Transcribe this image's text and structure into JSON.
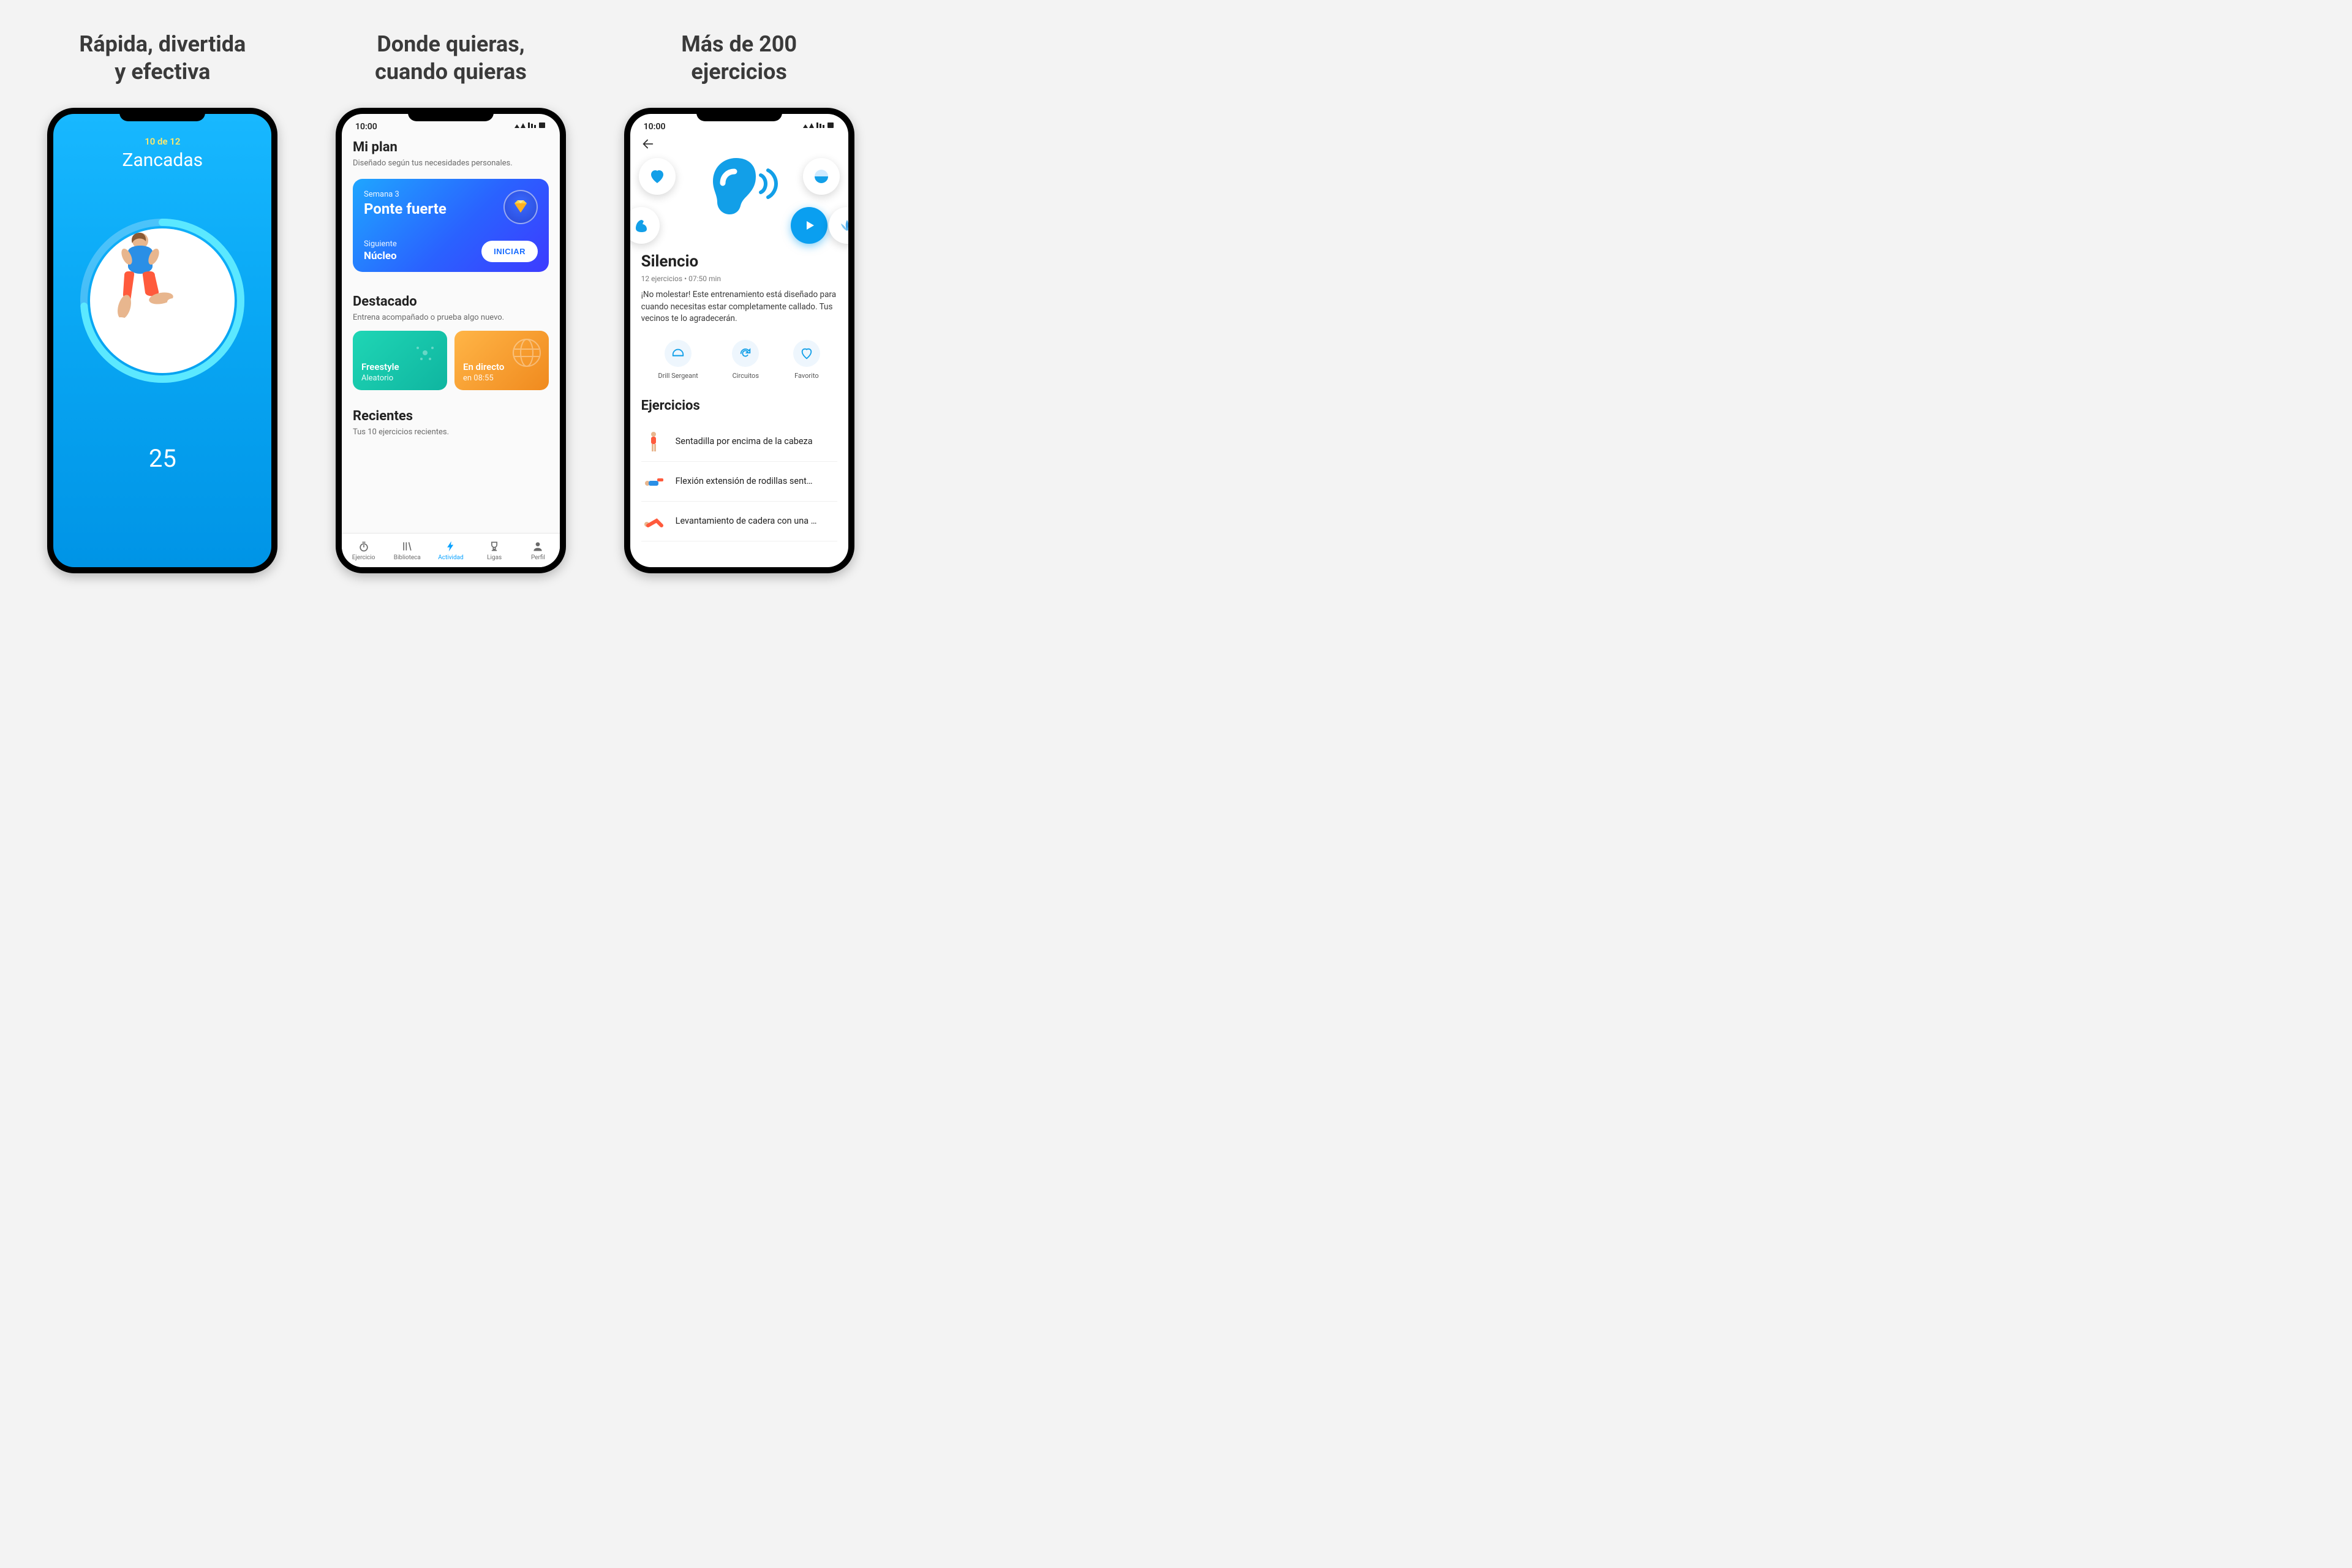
{
  "headlines": [
    "Rápida, divertida\ny efectiva",
    "Donde quieras,\ncuando quieras",
    "Más de 200\nejercicios"
  ],
  "colors": {
    "accent": "#0aa2ff",
    "gradient_plan": "#2a62ff"
  },
  "screen1": {
    "step": "10 de 12",
    "exercise": "Zancadas",
    "reps": "25"
  },
  "screen2": {
    "status_time": "10:00",
    "plan_title": "Mi plan",
    "plan_sub": "Diseñado según tus necesidades personales.",
    "week_label": "Semana 3",
    "plan_name": "Ponte fuerte",
    "next_label": "Siguiente",
    "next_value": "Núcleo",
    "start_btn": "INICIAR",
    "featured_title": "Destacado",
    "featured_sub": "Entrena acompañado o prueba algo nuevo.",
    "feat_a_title": "Freestyle",
    "feat_a_sub": "Aleatorio",
    "feat_b_title": "En directo",
    "feat_b_sub": "en 08:55",
    "recent_title": "Recientes",
    "recent_sub": "Tus 10 ejercicios recientes.",
    "tabs": [
      {
        "label": "Ejercicio"
      },
      {
        "label": "Biblioteca"
      },
      {
        "label": "Actividad"
      },
      {
        "label": "Ligas"
      },
      {
        "label": "Perfil"
      }
    ]
  },
  "screen3": {
    "status_time": "10:00",
    "title": "Silencio",
    "meta": "12 ejercicios • 07:50 min",
    "desc": "¡No molestar! Este entrenamiento está diseñado para cuando necesitas estar completamente callado. Tus vecinos te lo agradecerán.",
    "actions": [
      {
        "label": "Drill Sergeant"
      },
      {
        "label": "Circuitos"
      },
      {
        "label": "Favorito"
      }
    ],
    "ex_title": "Ejercicios",
    "exercises": [
      "Sentadilla por encima de la cabeza",
      "Flexión extensión de rodillas sent…",
      "Levantamiento de cadera con una …"
    ]
  }
}
